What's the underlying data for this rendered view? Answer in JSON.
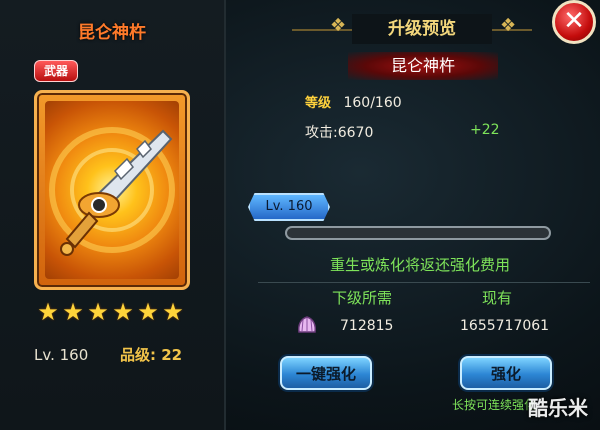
{
  "item": {
    "name": "昆仑神杵",
    "type_badge": "武器",
    "stars": [
      "★",
      "★",
      "★",
      "★",
      "★",
      "★"
    ],
    "level": "Lv. 160",
    "grade_label": "品级:",
    "grade_value": "22"
  },
  "panel": {
    "title": "升级预览",
    "close_symbol": "✕",
    "item_name": "昆仑神杵",
    "level_label": "等级",
    "level_value": "160/160",
    "attack": "攻击:6670",
    "attack_bonus": "+22",
    "lv_tag": "Lv. 160",
    "progress_fraction": 0.0,
    "notice": "重生或炼化将返还强化费用",
    "cost_header_required": "下级所需",
    "cost_header_owned": "现有",
    "cost_icon": "shell-icon",
    "required_value": "712815",
    "owned_value": "1655717061",
    "btn_one_key": "一键强化",
    "btn_enhance": "强化",
    "hint": "长按可连续强化",
    "watermark": "酷乐米"
  },
  "colors": {
    "accent_green": "#7ee35a",
    "title_orange": "#ff7a2a",
    "gold": "#f3d77c",
    "button_blue": "#2c86d4"
  }
}
